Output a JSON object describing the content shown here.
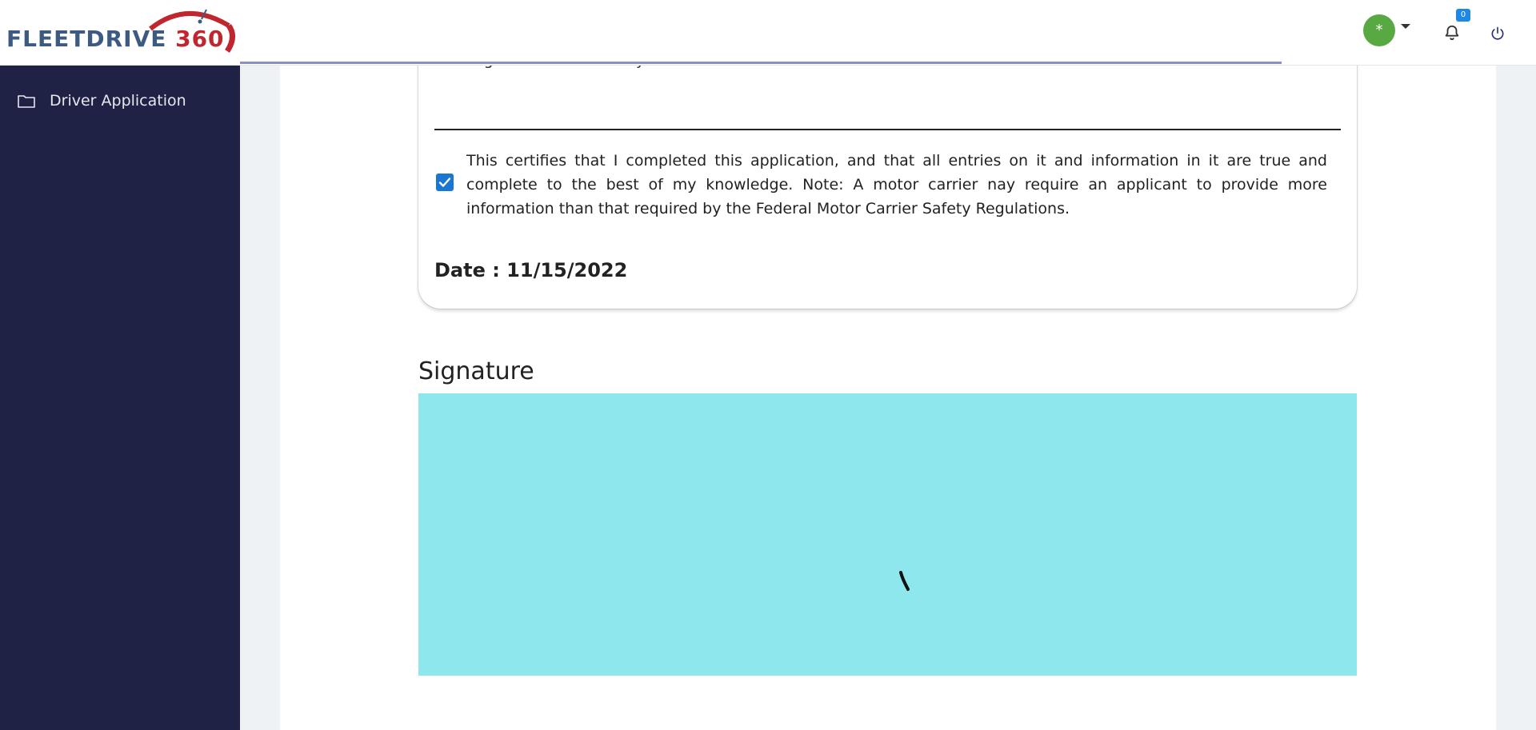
{
  "header": {
    "brand": {
      "word": "FLEETDRIVE",
      "number": "360"
    },
    "avatar_glyph": "*",
    "notification_count": "0",
    "icons": [
      "chevron-down-icon",
      "bell-icon",
      "power-icon"
    ]
  },
  "sidebar": {
    "items": [
      {
        "label": "Driver Application",
        "icon": "folder-icon"
      }
    ]
  },
  "form": {
    "previous_text": "agree on the accuracy of the information.",
    "certification": {
      "checked": true,
      "text": "This certifies that I completed this application, and that all entries on it and information in it are true and complete to the best of my knowledge. Note: A motor carrier nay require an applicant to provide more information than that required by the Federal Motor Carrier Safety Regulations."
    },
    "date_label": "Date : 11/15/2022"
  },
  "signature": {
    "title": "Signature"
  },
  "colors": {
    "sidebar": "#1f2145",
    "signature_pad": "#8fe7ee",
    "accent": "#1976d2",
    "avatar": "#58a942",
    "brand_blue": "#3d5a80",
    "brand_red": "#c0262d"
  }
}
